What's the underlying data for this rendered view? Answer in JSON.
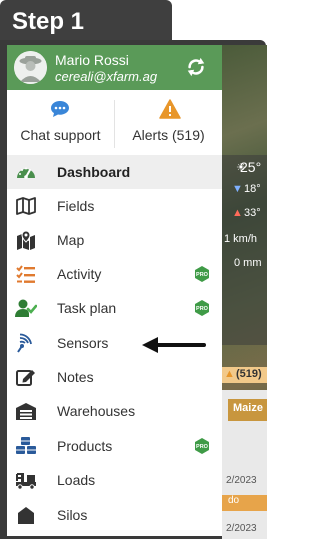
{
  "step_label": "Step 1",
  "user": {
    "name": "Mario Rossi",
    "email": "cereali@xfarm.ag"
  },
  "quick_actions": [
    {
      "id": "chat",
      "label": "Chat support",
      "icon": "chat-bubble-icon"
    },
    {
      "id": "alerts",
      "label": "Alerts (519)",
      "icon": "warning-icon"
    }
  ],
  "menu": [
    {
      "label": "Dashboard",
      "icon": "gauge-icon",
      "active": true,
      "pro": false
    },
    {
      "label": "Fields",
      "icon": "map-fold-icon",
      "active": false,
      "pro": false
    },
    {
      "label": "Map",
      "icon": "map-pin-icon",
      "active": false,
      "pro": false
    },
    {
      "label": "Activity",
      "icon": "checklist-icon",
      "active": false,
      "pro": true
    },
    {
      "label": "Task plan",
      "icon": "user-check-icon",
      "active": false,
      "pro": true
    },
    {
      "label": "Sensors",
      "icon": "sensor-icon",
      "active": false,
      "pro": false
    },
    {
      "label": "Notes",
      "icon": "edit-note-icon",
      "active": false,
      "pro": false
    },
    {
      "label": "Warehouses",
      "icon": "warehouse-icon",
      "active": false,
      "pro": false
    },
    {
      "label": "Products",
      "icon": "boxes-icon",
      "active": false,
      "pro": true
    },
    {
      "label": "Loads",
      "icon": "truck-icon",
      "active": false,
      "pro": false
    },
    {
      "label": "Silos",
      "icon": "silo-icon",
      "active": false,
      "pro": false
    }
  ],
  "pro_badge": "PRO",
  "background": {
    "temp": "25°",
    "temp_high": "18°",
    "temp_low": "33°",
    "wind": "1 km/h",
    "rain": "0 mm",
    "alerts_badge": "(519)",
    "crop_label": "Maize",
    "date1": "2/2023",
    "todo": "do",
    "date2": "2/2023"
  },
  "colors": {
    "header_green": "#5a9a58",
    "accent_orange": "#e8962a",
    "pro_green": "#3f9b47",
    "frame_dark": "#3f3f3f"
  }
}
